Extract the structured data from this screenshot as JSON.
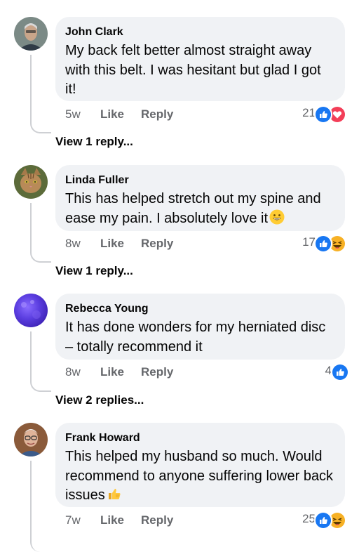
{
  "comments": [
    {
      "author": "John Clark",
      "text": "My back felt better almost straight away with this belt. I was hesitant but glad I got it!",
      "time": "5w",
      "like_label": "Like",
      "reply_label": "Reply",
      "reaction_count": "21",
      "reactions": [
        "like-reaction",
        "love-reaction"
      ],
      "view_replies": "View 1 reply..."
    },
    {
      "author": "Linda Fuller",
      "text": "This has helped stretch out my spine and ease my pain. I absolutely love it",
      "text_emoji": "grinning-face-emoji",
      "time": "8w",
      "like_label": "Like",
      "reply_label": "Reply",
      "reaction_count": "17",
      "reactions": [
        "like-reaction",
        "haha-reaction"
      ],
      "view_replies": "View 1 reply..."
    },
    {
      "author": "Rebecca Young",
      "text": "It has done wonders for my herniated disc – totally recommend it",
      "time": "8w",
      "like_label": "Like",
      "reply_label": "Reply",
      "reaction_count": "4",
      "reactions": [
        "like-reaction"
      ],
      "view_replies": "View 2 replies..."
    },
    {
      "author": "Frank Howard",
      "text": "This helped my husband so much. Would recommend to anyone suffering lower back issues",
      "text_emoji": "thumbs-up-emoji",
      "time": "7w",
      "like_label": "Like",
      "reply_label": "Reply",
      "reaction_count": "25",
      "reactions": [
        "like-reaction",
        "haha-reaction"
      ]
    }
  ],
  "colors": {
    "bubble": "#f0f2f5",
    "meta_text": "#65676b",
    "like_blue": "#1877f2",
    "love_red": "#f33e58",
    "haha_yellow": "#f7b125"
  }
}
